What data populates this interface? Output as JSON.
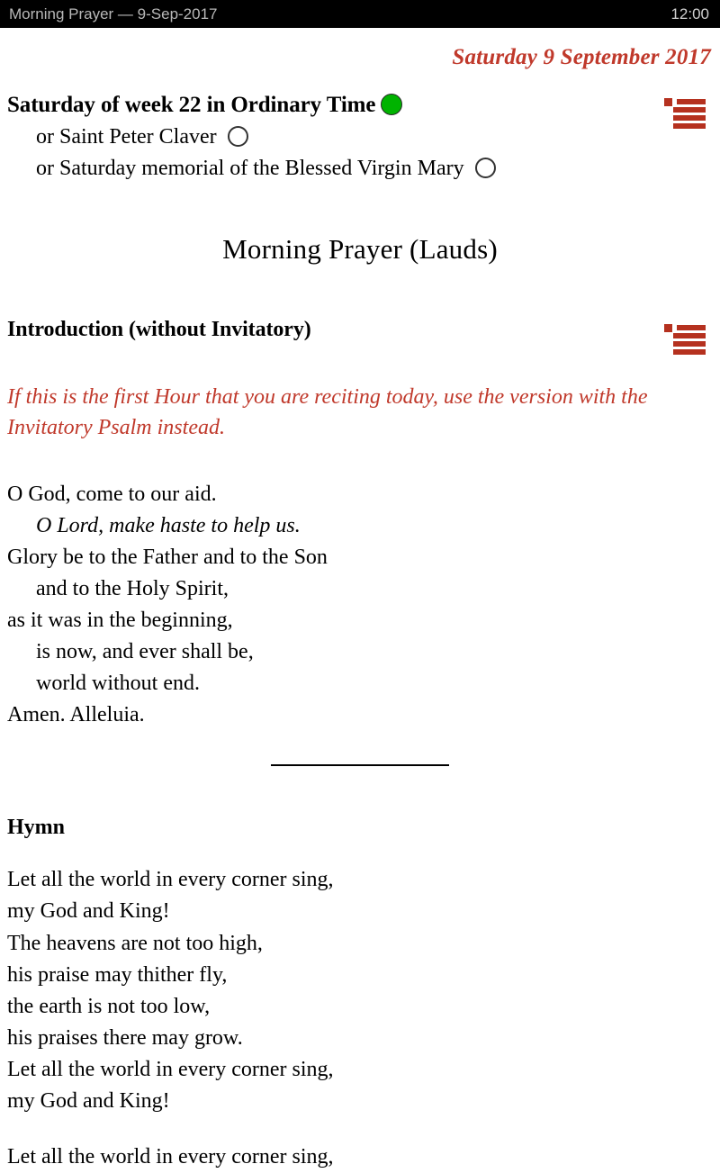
{
  "statusbar": {
    "title": "Morning Prayer — 9-Sep-2017",
    "clock": "12:00"
  },
  "colors": {
    "rubric_red": "#c0392b",
    "icon_red": "#b5311f",
    "feast_green": "#00b300",
    "statusbar_bg": "#000000",
    "page_bg": "#ffffff"
  },
  "header": {
    "date": "Saturday 9 September 2017"
  },
  "office": {
    "title": "Saturday of week 22 in Ordinary Time",
    "title_marker": "filled-green-circle",
    "alternatives": [
      {
        "label": "or Saint Peter Claver",
        "marker": "empty-circle"
      },
      {
        "label": "or Saturday memorial of the Blessed Virgin Mary",
        "marker": "empty-circle"
      }
    ],
    "menu_icon": "index-menu-icon"
  },
  "hour": {
    "title": "Morning Prayer (Lauds)"
  },
  "introduction": {
    "heading": "Introduction (without Invitatory)",
    "menu_icon": "index-menu-icon",
    "rubric": "If this is the first Hour that you are reciting today, use the version with the Invitatory Psalm instead.",
    "verses": [
      {
        "text": "O God, come to our aid.",
        "indent": false,
        "italic": false
      },
      {
        "text": "O Lord, make haste to help us.",
        "indent": true,
        "italic": true
      },
      {
        "text": "Glory be to the Father and to the Son",
        "indent": false,
        "italic": false
      },
      {
        "text": "and to the Holy Spirit,",
        "indent": true,
        "italic": false
      },
      {
        "text": "as it was in the beginning,",
        "indent": false,
        "italic": false
      },
      {
        "text": "is now, and ever shall be,",
        "indent": true,
        "italic": false
      },
      {
        "text": "world without end.",
        "indent": true,
        "italic": false
      },
      {
        "text": "Amen. Alleluia.",
        "indent": false,
        "italic": false
      }
    ]
  },
  "hymn": {
    "heading": "Hymn",
    "stanzas": [
      {
        "lines": [
          "Let all the world in every corner sing,",
          "my God and King!",
          "The heavens are not too high,",
          "his praise may thither fly,",
          "the earth is not too low,",
          "his praises there may grow.",
          "Let all the world in every corner sing,",
          "my God and King!"
        ]
      },
      {
        "lines": [
          "Let all the world in every corner sing,"
        ]
      }
    ]
  }
}
